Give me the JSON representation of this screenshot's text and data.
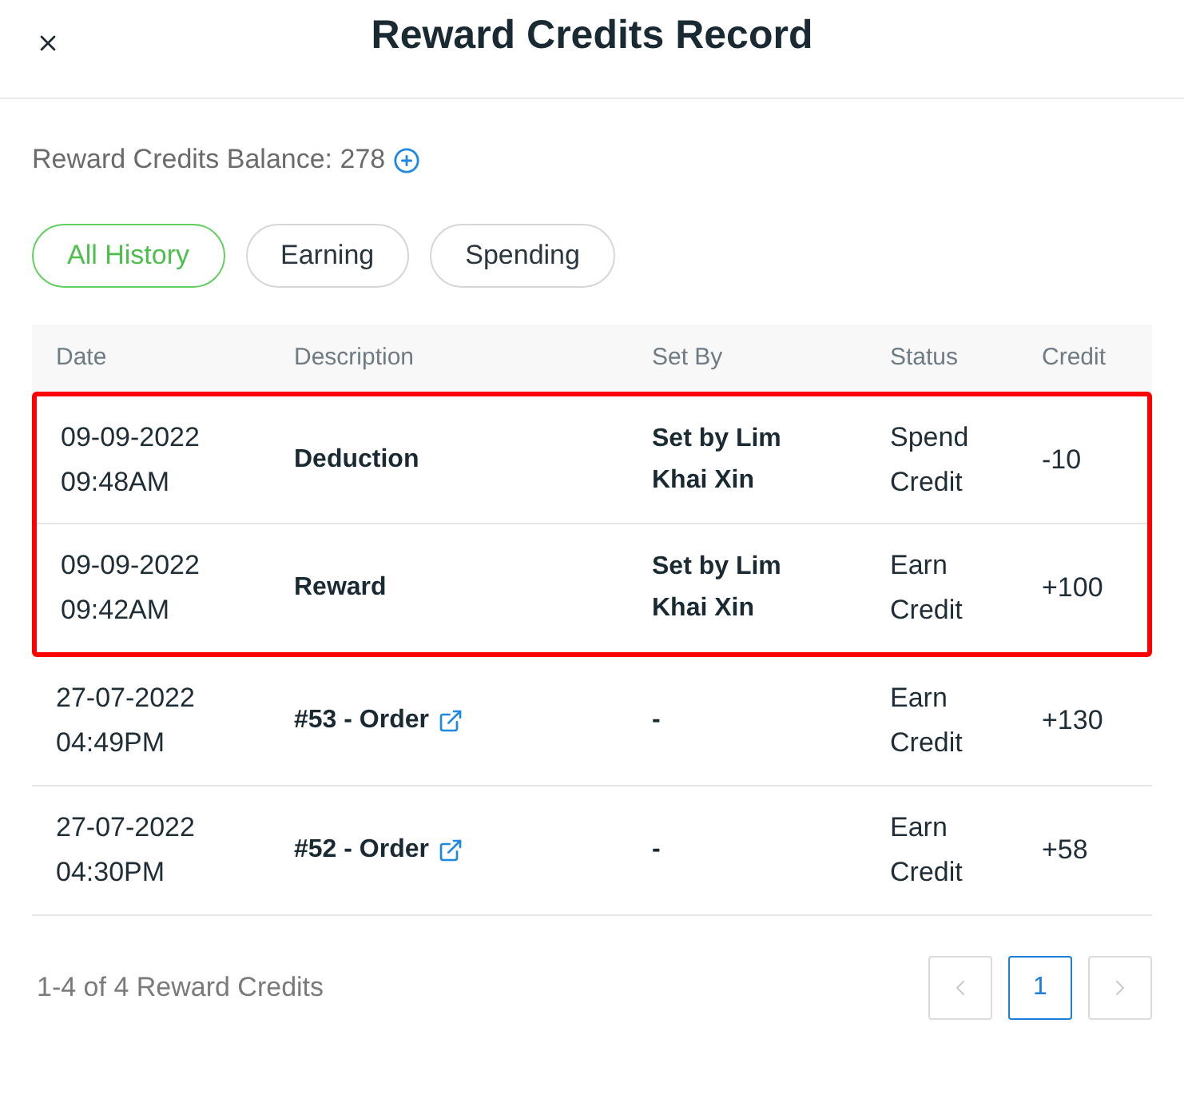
{
  "window": {
    "title": "Reward Credits Record"
  },
  "balance": {
    "label": "Reward Credits Balance: 278"
  },
  "filters": [
    {
      "label": "All History",
      "selected": true
    },
    {
      "label": "Earning",
      "selected": false
    },
    {
      "label": "Spending",
      "selected": false
    }
  ],
  "table": {
    "columns": [
      "Date",
      "Description",
      "Set By",
      "Status",
      "Credit"
    ],
    "rows": [
      {
        "date": "09-09-2022 09:48AM",
        "description": "Deduction",
        "link": false,
        "set_by": "Set by Lim Khai Xin",
        "status": "Spend Credit",
        "credit": "-10",
        "highlighted": true
      },
      {
        "date": "09-09-2022 09:42AM",
        "description": "Reward",
        "link": false,
        "set_by": "Set by Lim Khai Xin",
        "status": "Earn Credit",
        "credit": "+100",
        "highlighted": true
      },
      {
        "date": "27-07-2022 04:49PM",
        "description": "#53 - Order",
        "link": true,
        "set_by": "-",
        "status": "Earn Credit",
        "credit": "+130",
        "highlighted": false
      },
      {
        "date": "27-07-2022 04:30PM",
        "description": "#52 - Order",
        "link": true,
        "set_by": "-",
        "status": "Earn Credit",
        "credit": "+58",
        "highlighted": false
      }
    ]
  },
  "footer": {
    "summary": "1-4 of 4 Reward Credits",
    "previous_disabled": true,
    "next_disabled": true,
    "pages": [
      {
        "label": "1",
        "selected": true
      }
    ]
  }
}
